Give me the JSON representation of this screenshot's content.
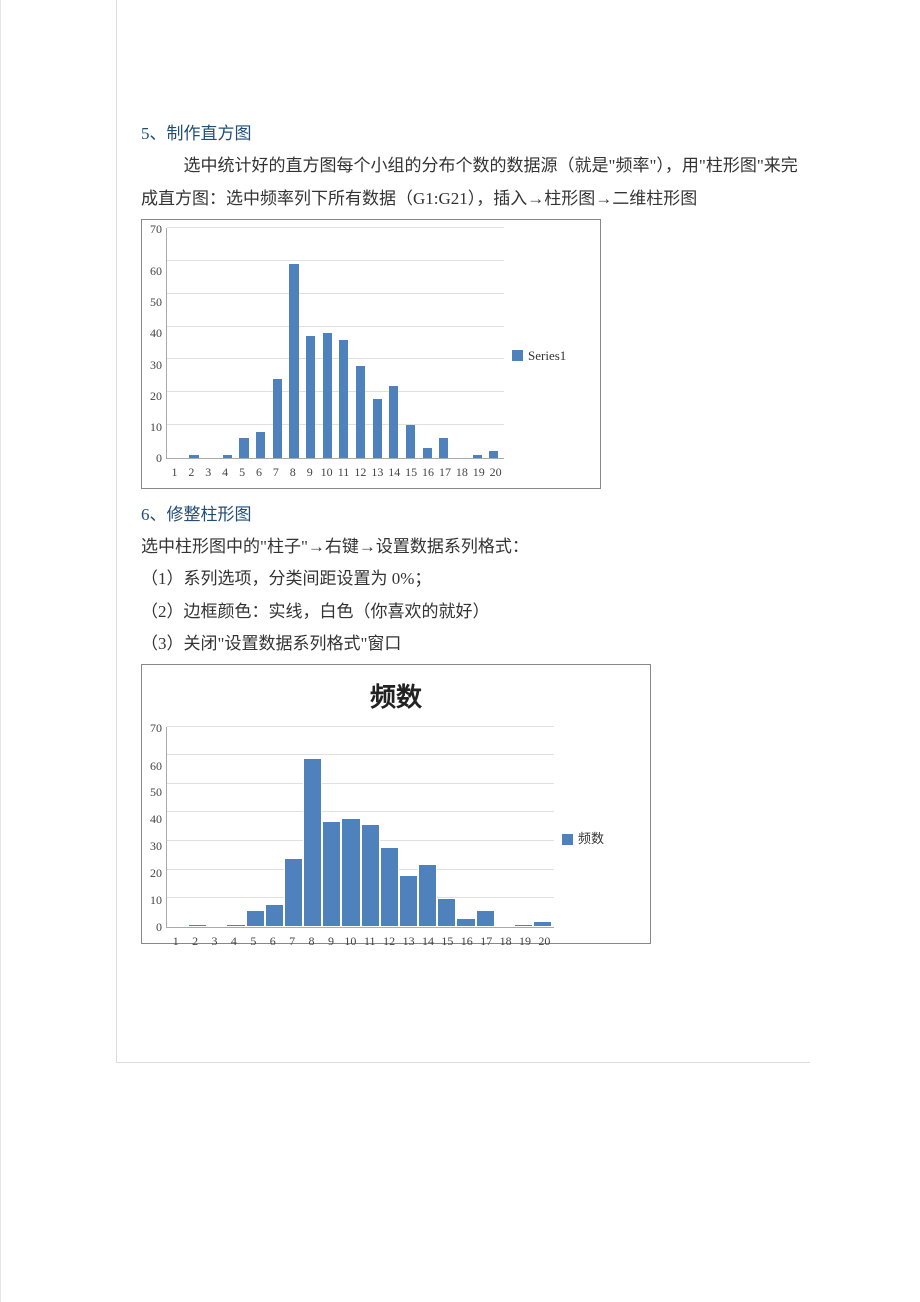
{
  "section5": {
    "heading": "5、制作直方图",
    "p1": "选中统计好的直方图每个小组的分布个数的数据源（就是\"频率\"），用\"柱形图\"来完成直方图：选中频率列下所有数据（G1:G21），插入→柱形图→二维柱形图"
  },
  "section6": {
    "heading": "6、修整柱形图",
    "p1": "选中柱形图中的\"柱子\"→右键→设置数据系列格式：",
    "li1": "（1）系列选项，分类间距设置为 0%；",
    "li2": "（2）边框颜色：实线，白色（你喜欢的就好）",
    "li3": "（3）关闭\"设置数据系列格式\"窗口"
  },
  "chart_data": [
    {
      "type": "bar",
      "id": "chart1",
      "categories": [
        "1",
        "2",
        "3",
        "4",
        "5",
        "6",
        "7",
        "8",
        "9",
        "10",
        "11",
        "12",
        "13",
        "14",
        "15",
        "16",
        "17",
        "18",
        "19",
        "20"
      ],
      "values": [
        0,
        1,
        0,
        1,
        6,
        8,
        24,
        59,
        37,
        38,
        36,
        28,
        18,
        22,
        10,
        3,
        6,
        0,
        1,
        2
      ],
      "title": "",
      "xlabel": "",
      "ylabel": "",
      "ylim": [
        0,
        70
      ],
      "yticks": [
        0,
        10,
        20,
        30,
        40,
        50,
        60,
        70
      ],
      "legend": "Series1",
      "bar_gap": true
    },
    {
      "type": "bar",
      "id": "chart2",
      "categories": [
        "1",
        "2",
        "3",
        "4",
        "5",
        "6",
        "7",
        "8",
        "9",
        "10",
        "11",
        "12",
        "13",
        "14",
        "15",
        "16",
        "17",
        "18",
        "19",
        "20"
      ],
      "values": [
        0,
        1,
        0,
        1,
        6,
        8,
        24,
        59,
        37,
        38,
        36,
        28,
        18,
        22,
        10,
        3,
        6,
        0,
        1,
        2
      ],
      "title": "频数",
      "xlabel": "",
      "ylabel": "",
      "ylim": [
        0,
        70
      ],
      "yticks": [
        0,
        10,
        20,
        30,
        40,
        50,
        60,
        70
      ],
      "legend": "频数",
      "bar_gap": false
    }
  ],
  "colors": {
    "bar": "#4f81bd",
    "heading": "#1f4e79"
  }
}
